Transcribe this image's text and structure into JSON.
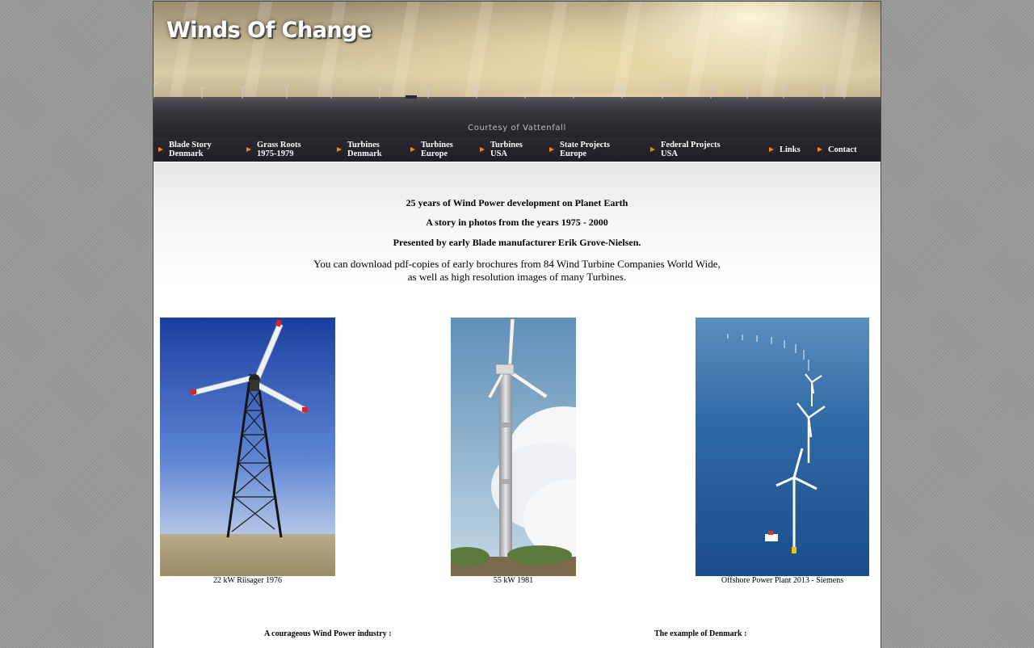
{
  "site": {
    "logo_text": "Winds Of Change",
    "photo_credit": "Courtesy of Vattenfall"
  },
  "nav": {
    "items": [
      {
        "line1": "Blade Story",
        "line2": "Denmark"
      },
      {
        "line1": "Grass Roots",
        "line2": "1975-1979"
      },
      {
        "line1": "Turbines",
        "line2": "Denmark"
      },
      {
        "line1": "Turbines",
        "line2": "Europe"
      },
      {
        "line1": "Turbines",
        "line2": "USA"
      },
      {
        "line1": "State Projects",
        "line2": "Europe"
      },
      {
        "line1": "Federal Projects",
        "line2": "USA"
      },
      {
        "line1": "Links",
        "line2": ""
      },
      {
        "line1": "Contact",
        "line2": ""
      }
    ]
  },
  "intro": {
    "heading": "25 years of Wind Power development on Planet Earth",
    "subheading": "A story in photos from the years 1975 - 2000",
    "presenter": "Presented by early Blade manufacturer Erik Grove-Nielsen.",
    "download_line1": "You can download pdf-copies of early brochures from 84 Wind Turbine Companies World Wide,",
    "download_line2": "as well as high resolution images of many Turbines."
  },
  "photos": [
    {
      "caption": "22 kW Riisager 1976"
    },
    {
      "caption": "55 kW 1981"
    },
    {
      "caption": "Offshore Power Plant 2013 - Siemens"
    }
  ],
  "sections": {
    "left_heading": "A courageous Wind Power industry :",
    "right_heading": "The example of Denmark :"
  },
  "colors": {
    "nav_background": "#1f1f23",
    "nav_arrow": "#e8862a",
    "page_background": "#9a9a9a"
  }
}
